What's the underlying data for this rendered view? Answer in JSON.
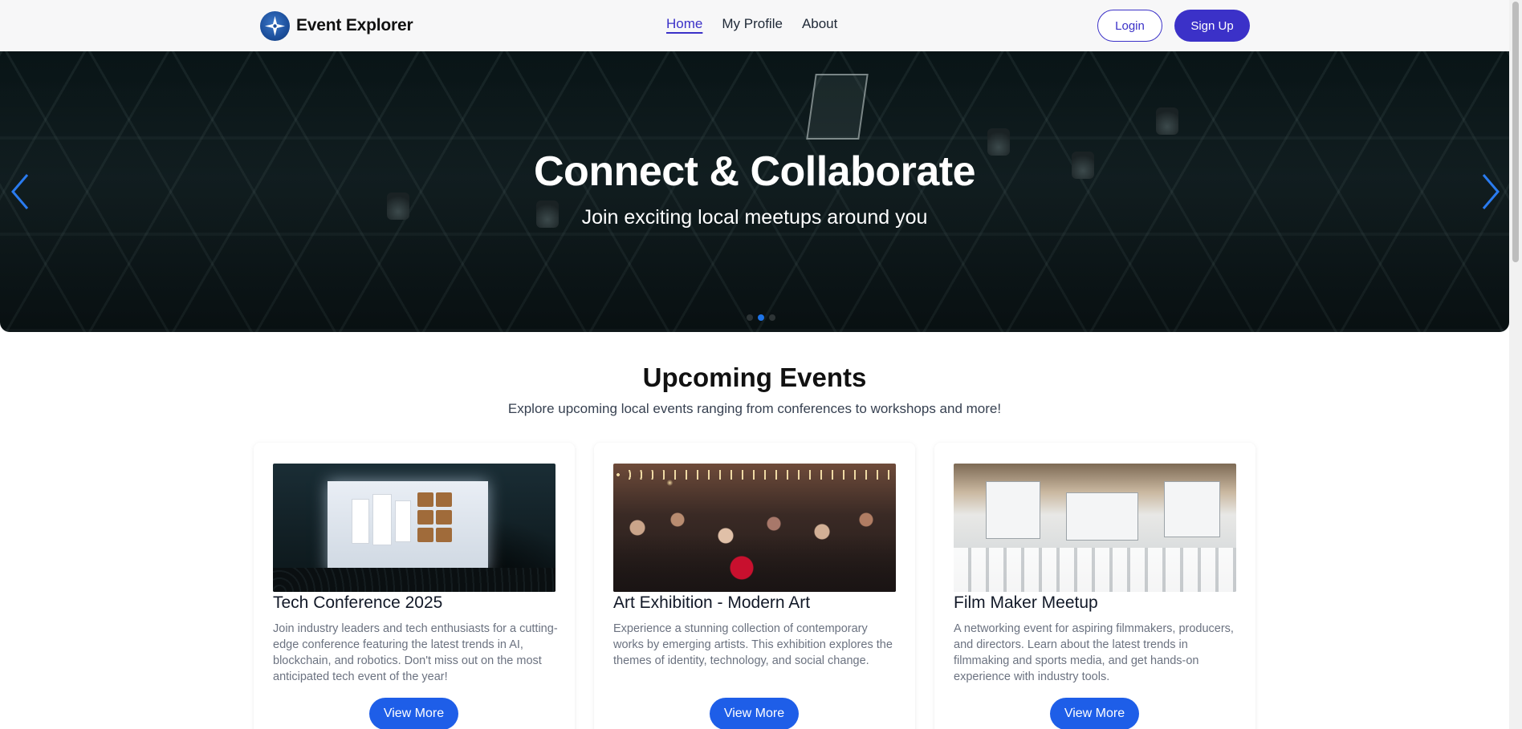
{
  "navbar": {
    "brand": "Event Explorer",
    "logo_icon": "compass-logo-icon",
    "links": [
      {
        "label": "Home",
        "active": true
      },
      {
        "label": "My Profile",
        "active": false
      },
      {
        "label": "About",
        "active": false
      }
    ],
    "login_label": "Login",
    "signup_label": "Sign Up"
  },
  "hero": {
    "title": "Connect & Collaborate",
    "subtitle": "Join exciting local meetups around you",
    "prev_icon": "chevron-left-icon",
    "next_icon": "chevron-right-icon",
    "slides_total": 3,
    "active_slide": 2
  },
  "section": {
    "title": "Upcoming Events",
    "subtitle": "Explore upcoming local events ranging from conferences to workshops and more!"
  },
  "events": [
    {
      "title": "Tech Conference 2025",
      "description": "Join industry leaders and tech enthusiasts for a cutting-edge conference featuring the latest trends in AI, blockchain, and robotics. Don't miss out on the most anticipated tech event of the year!",
      "button": "View More"
    },
    {
      "title": "Art Exhibition - Modern Art",
      "description": "Experience a stunning collection of contemporary works by emerging artists. This exhibition explores the themes of identity, technology, and social change.",
      "button": "View More"
    },
    {
      "title": "Film Maker Meetup",
      "description": "A networking event for aspiring filmmakers, producers, and directors. Learn about the latest trends in filmmaking and sports media, and get hands-on experience with industry tools.",
      "button": "View More"
    }
  ],
  "colors": {
    "primary": "#3b31c8",
    "button_blue": "#1e5ee8",
    "active_dot": "#1e74e8"
  }
}
